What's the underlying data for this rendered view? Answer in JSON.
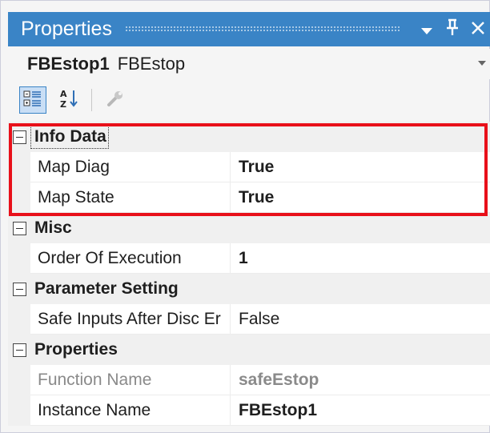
{
  "titlebar": {
    "title": "Properties",
    "dropdown_icon": "chevron-down-icon",
    "pin_icon": "pin-icon",
    "close_icon": "close-icon"
  },
  "object": {
    "name": "FBEstop1",
    "type": "FBEstop"
  },
  "toolbar": {
    "categorized_icon": "categorized-icon",
    "alphabetical_icon": "alphabetical-sort-icon",
    "property_pages_icon": "wrench-icon"
  },
  "grid": {
    "categories": [
      {
        "label": "Info Data",
        "properties": [
          {
            "name": "Map Diag",
            "value": "True"
          },
          {
            "name": "Map State",
            "value": "True"
          }
        ]
      },
      {
        "label": "Misc",
        "properties": [
          {
            "name": "Order Of Execution",
            "value": "1"
          }
        ]
      },
      {
        "label": "Parameter Setting",
        "properties": [
          {
            "name": "Safe Inputs After Disc Er",
            "value": "False"
          }
        ]
      },
      {
        "label": "Properties",
        "properties": [
          {
            "name": "Function Name",
            "value": "safeEstop"
          },
          {
            "name": "Instance Name",
            "value": "FBEstop1"
          }
        ]
      }
    ]
  },
  "colors": {
    "titlebar": "#3a84c6",
    "highlight": "#e8101a"
  }
}
